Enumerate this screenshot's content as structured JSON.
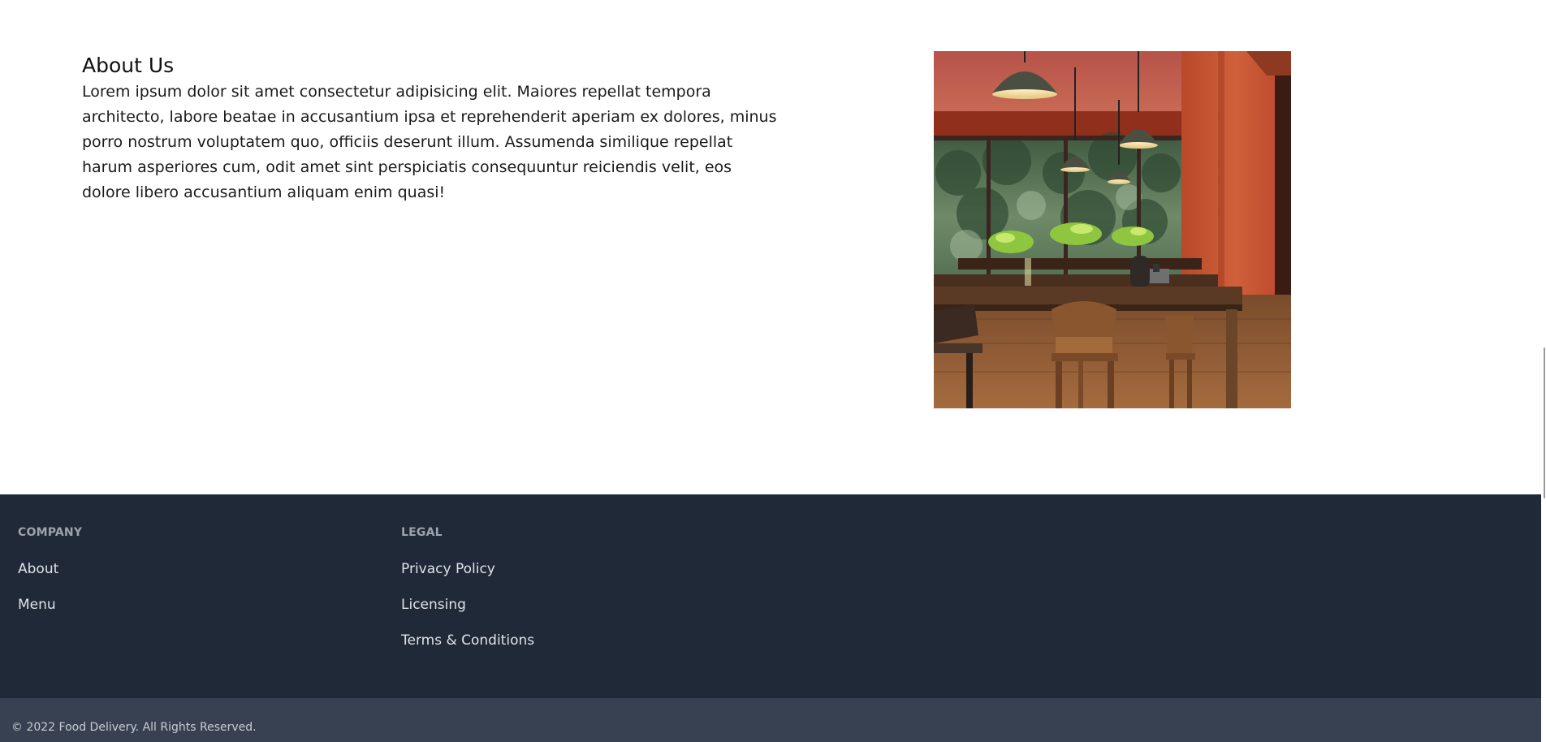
{
  "about": {
    "title": "About Us",
    "body": "Lorem ipsum dolor sit amet consectetur adipisicing elit. Maiores repellat tempora architecto, labore beatae in accusantium ipsa et reprehenderit aperiam ex dolores, minus porro nostrum voluptatem quo, officiis deserunt illum. Assumenda similique repellat harum asperiores cum, odit amet sint perspiciatis consequuntur reiciendis velit, eos dolore libero accusantium aliquam enim quasi!",
    "image": "restaurant-interior-image"
  },
  "footer": {
    "company": {
      "heading": "COMPANY",
      "links": [
        "About",
        "Menu"
      ]
    },
    "legal": {
      "heading": "LEGAL",
      "links": [
        "Privacy Policy",
        "Licensing",
        "Terms & Conditions"
      ]
    },
    "copyright": "© 2022 Food Delivery. All Rights Reserved."
  },
  "colors": {
    "footer_bg": "#202938",
    "footer_bottom_bg": "#374151",
    "accent_wall": "#c8532e"
  }
}
